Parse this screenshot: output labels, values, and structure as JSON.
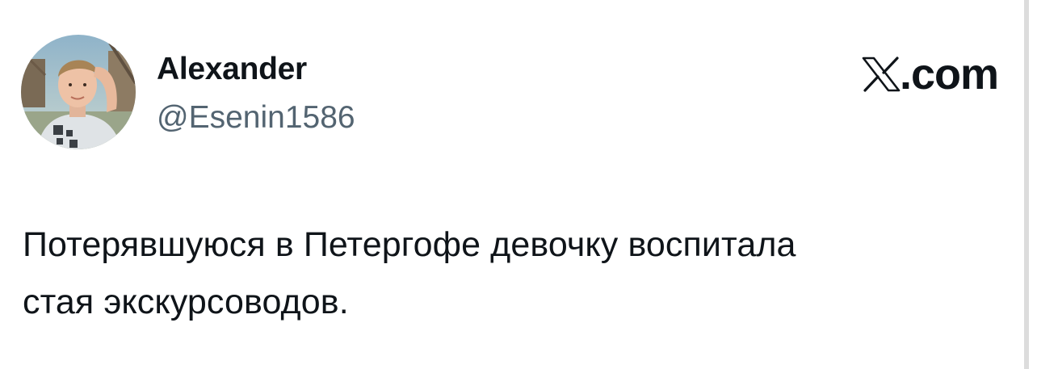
{
  "author": {
    "display_name": "Alexander",
    "handle": "@Esenin1586",
    "avatar_icon": "avatar-photo"
  },
  "brand": {
    "icon": "x-logo-icon",
    "suffix": ".com"
  },
  "tweet": {
    "line1": "Потерявшуюся в Петергофе девочку воспитала",
    "line2": "стая экскурсоводов."
  },
  "colors": {
    "text": "#0f1419",
    "secondary": "#536471",
    "background": "#ffffff"
  }
}
